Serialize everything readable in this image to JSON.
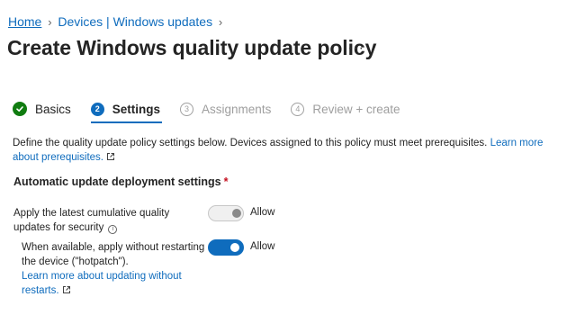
{
  "breadcrumb": {
    "home": "Home",
    "sep": ">",
    "devices": "Devices | Windows updates"
  },
  "page_title": "Create Windows quality update policy",
  "more_label": "···",
  "steps": [
    {
      "number": "✓",
      "label": "Basics",
      "state": "done"
    },
    {
      "number": "2",
      "label": "Settings",
      "state": "active"
    },
    {
      "number": "3",
      "label": "Assignments",
      "state": "pending"
    },
    {
      "number": "4",
      "label": "Review + create",
      "state": "pending"
    }
  ],
  "description": {
    "text": "Define the quality update policy settings below. Devices assigned to this policy must meet prerequisites.",
    "link": "Learn more about prerequisites."
  },
  "section": {
    "title": "Automatic update deployment settings",
    "required_mark": "*"
  },
  "settings": {
    "security": {
      "label": "Apply the latest cumulative quality updates for security",
      "info_glyph": "i",
      "toggle_label": "Allow",
      "state": "disabled"
    },
    "hotpatch": {
      "label": "When available, apply without restarting the device (\"hotpatch\").",
      "link": "Learn more about updating without restarts.",
      "toggle_label": "Allow",
      "state": "on"
    }
  },
  "colors": {
    "accent": "#0f6cbd",
    "success": "#107c10",
    "required": "#c50f1f"
  }
}
